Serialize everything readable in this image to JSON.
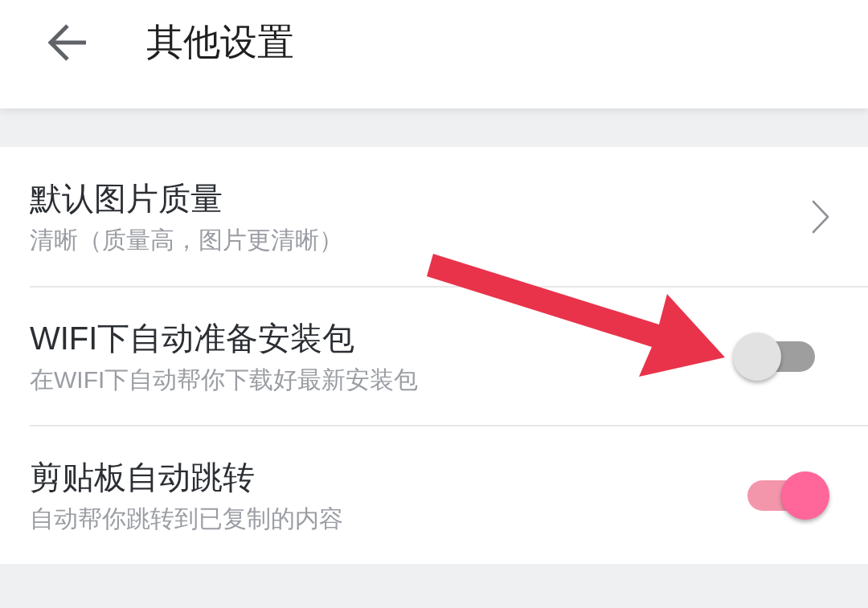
{
  "header": {
    "title": "其他设置"
  },
  "settings": [
    {
      "kind": "link",
      "title": "默认图片质量",
      "subtitle": "清晰（质量高，图片更清晰）"
    },
    {
      "kind": "switch",
      "title": "WIFI下自动准备安装包",
      "subtitle": "在WIFI下自动帮你下载好最新安装包",
      "on": false
    },
    {
      "kind": "switch",
      "title": "剪贴板自动跳转",
      "subtitle": "自动帮你跳转到已复制的内容",
      "on": true
    }
  ]
}
